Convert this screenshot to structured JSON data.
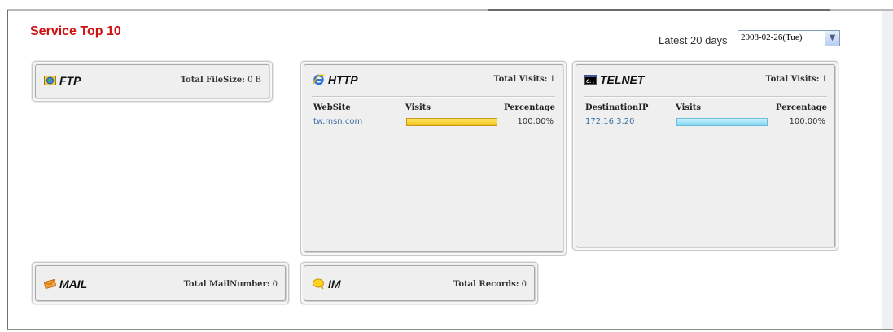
{
  "header": {
    "title": "Service Top 10",
    "period_label": "Latest 20 days",
    "date_selected": "2008-02-26(Tue)"
  },
  "panels": {
    "ftp": {
      "title": "FTP",
      "stat_label": "Total FileSize:",
      "stat_value": "0 B",
      "icon": "globe-folder-icon"
    },
    "http": {
      "title": "HTTP",
      "stat_label": "Total Visits:",
      "stat_value": "1",
      "icon": "internet-explorer-icon",
      "columns": [
        "WebSite",
        "Visits",
        "Percentage"
      ],
      "rows": [
        {
          "site": "tw.msn.com",
          "visits_fraction": 1.0,
          "percentage": "100.00%"
        }
      ]
    },
    "telnet": {
      "title": "TELNET",
      "stat_label": "Total Visits:",
      "stat_value": "1",
      "icon": "terminal-icon",
      "columns": [
        "DestinationIP",
        "Visits",
        "Percentage"
      ],
      "rows": [
        {
          "ip": "172.16.3.20",
          "visits_fraction": 1.0,
          "percentage": "100.00%"
        }
      ]
    },
    "mail": {
      "title": "MAIL",
      "stat_label": "Total MailNumber:",
      "stat_value": "0",
      "icon": "envelope-icon"
    },
    "im": {
      "title": "IM",
      "stat_label": "Total Records:",
      "stat_value": "0",
      "icon": "chat-bubble-icon"
    }
  },
  "colors": {
    "title_red": "#cc1111",
    "link_blue": "#3a6ea5",
    "http_bar": "#f1c21c",
    "telnet_bar": "#84d7f2"
  }
}
